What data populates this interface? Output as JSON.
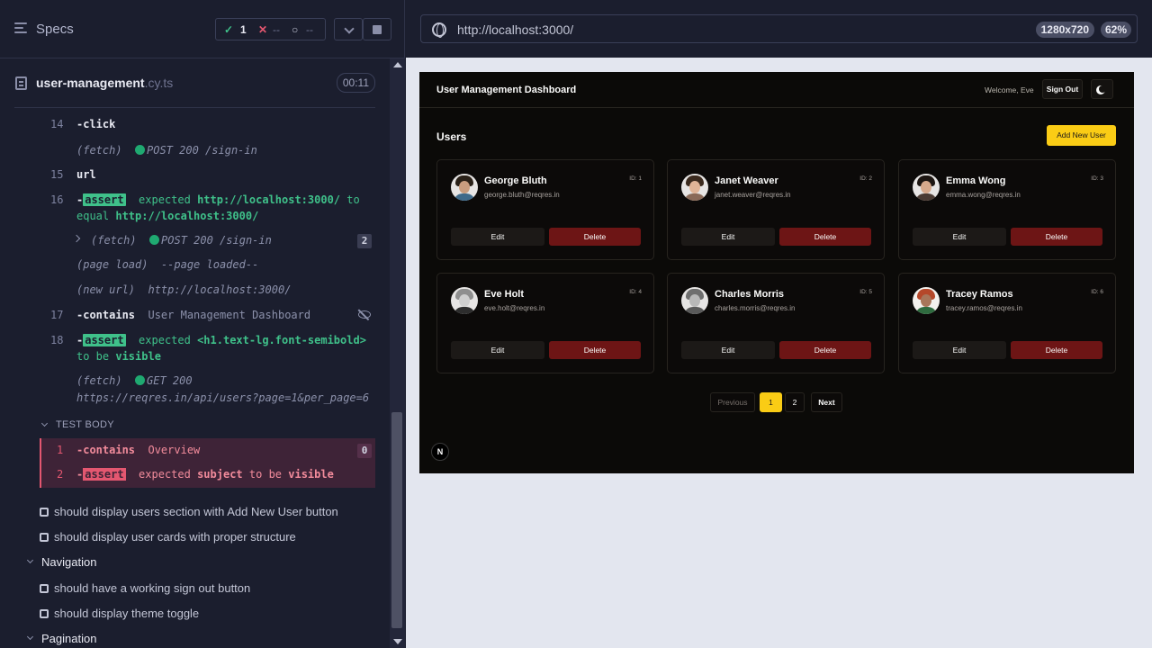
{
  "reporter": {
    "title": "Specs",
    "stats": {
      "passed_icon": "✓",
      "passed": "1",
      "failed_icon": "✕",
      "failed": "--",
      "pending_icon": "○",
      "pending": "--"
    },
    "file": {
      "name": "user-management",
      "ext": ".cy.ts",
      "duration": "00:11"
    },
    "commands": [
      {
        "num": "14",
        "name": "-click"
      },
      {
        "text": "(fetch)",
        "method": "POST 200 /sign-in"
      },
      {
        "num": "15",
        "name": "url"
      },
      {
        "num": "16",
        "tag": "assert",
        "w1": "expected",
        "v1": "http://localhost:3000/",
        "w2": "to",
        "w3": "equal",
        "v2": "http://localhost:3000/"
      },
      {
        "text": "(fetch)",
        "method": "POST 200 /sign-in",
        "badge": "2"
      },
      {
        "text": "(page load)",
        "detail": "--page loaded--"
      },
      {
        "text": "(new url)",
        "detail": "http://localhost:3000/"
      },
      {
        "num": "17",
        "name": "-contains",
        "detail": "User Management Dashboard"
      },
      {
        "num": "18",
        "tag": "assert",
        "w1": "expected",
        "v1": "<h1.text-lg.font-semibold>",
        "w2": "to be",
        "v2": "visible"
      },
      {
        "text": "(fetch)",
        "method": "GET 200",
        "url": "https://reqres.in/api/users?page=1&per_page=6"
      }
    ],
    "test_body": {
      "label": "TEST BODY",
      "rows": [
        {
          "num": "1",
          "name": "-contains",
          "detail": "Overview",
          "badge": "0"
        },
        {
          "num": "2",
          "tag": "assert",
          "w1": "expected",
          "v1": "subject",
          "w2": "to be",
          "v2": "visible"
        }
      ]
    },
    "tests": [
      "should display users section with Add New User button",
      "should display user cards with proper structure"
    ],
    "suite_nav": "Navigation",
    "nav_tests": [
      "should have a working sign out button",
      "should display theme toggle"
    ],
    "suite_pagination": "Pagination"
  },
  "browser": {
    "url": "http://localhost:3000/",
    "viewport": "1280x720",
    "zoom": "62%"
  },
  "app": {
    "title": "User Management Dashboard",
    "welcome": "Welcome, Eve",
    "sign_out": "Sign Out",
    "users_title": "Users",
    "add_user": "Add New User",
    "edit_label": "Edit",
    "delete_label": "Delete",
    "users": [
      {
        "name": "George Bluth",
        "email": "george.bluth@reqres.in",
        "id": "ID: 1"
      },
      {
        "name": "Janet Weaver",
        "email": "janet.weaver@reqres.in",
        "id": "ID: 2"
      },
      {
        "name": "Emma Wong",
        "email": "emma.wong@reqres.in",
        "id": "ID: 3"
      },
      {
        "name": "Eve Holt",
        "email": "eve.holt@reqres.in",
        "id": "ID: 4"
      },
      {
        "name": "Charles Morris",
        "email": "charles.morris@reqres.in",
        "id": "ID: 5"
      },
      {
        "name": "Tracey Ramos",
        "email": "tracey.ramos@reqres.in",
        "id": "ID: 6"
      }
    ],
    "pagination": {
      "previous": "Previous",
      "pages": [
        "1",
        "2"
      ],
      "next": "Next",
      "current": "1"
    },
    "logo_letter": "N"
  }
}
